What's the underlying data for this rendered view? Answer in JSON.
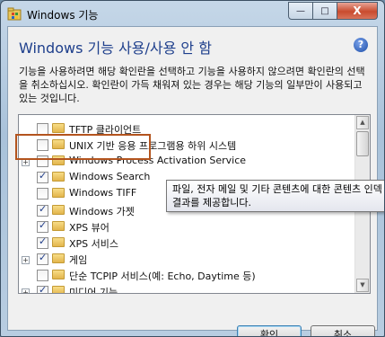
{
  "window": {
    "title": "Windows 기능",
    "buttons": {
      "minimize": "—",
      "maximize": "□",
      "close": "X"
    }
  },
  "dialog": {
    "heading": "Windows 기능 사용/사용 안 함",
    "help": "?",
    "description": "기능을 사용하려면 해당 확인란을 선택하고 기능을 사용하지 않으려면 확인란의 선택을 취소하십시오. 확인란이 가득 채워져 있는 경우는 해당 기능의 일부만이 사용되고 있는 것입니다."
  },
  "features": [
    {
      "label": "TFTP 클라이언트",
      "checked": false,
      "expandable": false
    },
    {
      "label": "UNIX 기반 응용 프로그램용 하위 시스템",
      "checked": false,
      "expandable": false
    },
    {
      "label": "Windows Process Activation Service",
      "checked": false,
      "expandable": true
    },
    {
      "label": "Windows Search",
      "checked": true,
      "expandable": false
    },
    {
      "label": "Windows TIFF",
      "checked": false,
      "expandable": false
    },
    {
      "label": "Windows 가젯",
      "checked": true,
      "expandable": false
    },
    {
      "label": "XPS 뷰어",
      "checked": true,
      "expandable": false
    },
    {
      "label": "XPS 서비스",
      "checked": true,
      "expandable": false
    },
    {
      "label": "게임",
      "checked": true,
      "expandable": true
    },
    {
      "label": "단순 TCPIP 서비스(예: Echo, Daytime 등)",
      "checked": false,
      "expandable": false
    },
    {
      "label": "미디어 기능",
      "checked": true,
      "expandable": true
    }
  ],
  "tooltip": {
    "line1": "파일, 전자 메일 및 기타 콘텐츠에 대한 콘텐츠 인덱",
    "line2": "결과를 제공합니다."
  },
  "footer": {
    "ok_label": "확인",
    "cancel_label": "취소"
  },
  "colors": {
    "heading": "#1e3f8c",
    "highlight_border": "#b3541e",
    "checkmark": "#1f3c88"
  }
}
